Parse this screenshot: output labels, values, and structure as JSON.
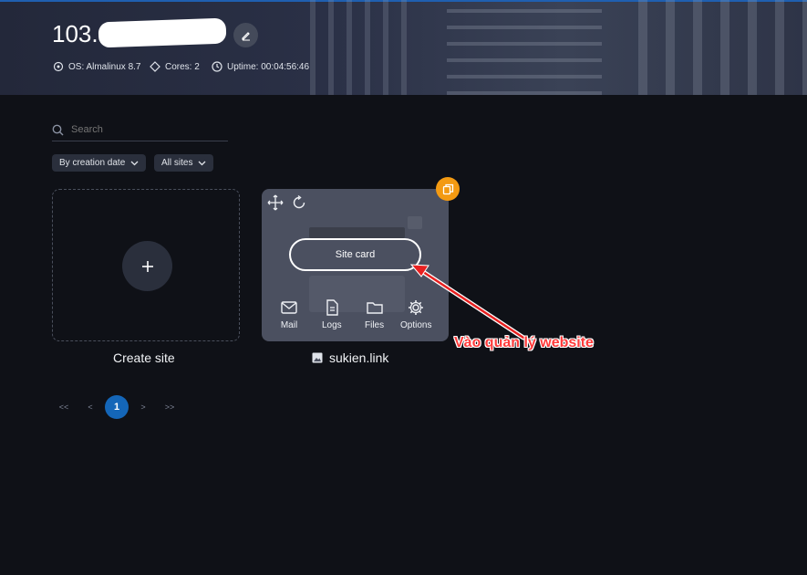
{
  "server": {
    "ip_prefix": "103.",
    "os": "OS: Almalinux 8.7",
    "cores": "Cores: 2",
    "uptime": "Uptime: 00:04:56:46"
  },
  "search": {
    "placeholder": "Search"
  },
  "filters": {
    "sort": "By creation date",
    "scope": "All sites"
  },
  "create_card": {
    "caption": "Create site"
  },
  "site": {
    "name": "sukien.link",
    "card_button": "Site card",
    "tools": [
      {
        "label": "Mail",
        "icon": "mail-icon"
      },
      {
        "label": "Logs",
        "icon": "logs-icon"
      },
      {
        "label": "Files",
        "icon": "folder-icon"
      },
      {
        "label": "Options",
        "icon": "gear-icon"
      }
    ]
  },
  "pagination": {
    "first": "<<",
    "prev": "<",
    "current": "1",
    "next": ">",
    "last": ">>"
  },
  "annotation": {
    "text": "Vào quản lý website",
    "color": "#ff3b3b"
  },
  "colors": {
    "accent": "#1466b8",
    "badge": "#f39a12",
    "background": "#0f1117"
  }
}
